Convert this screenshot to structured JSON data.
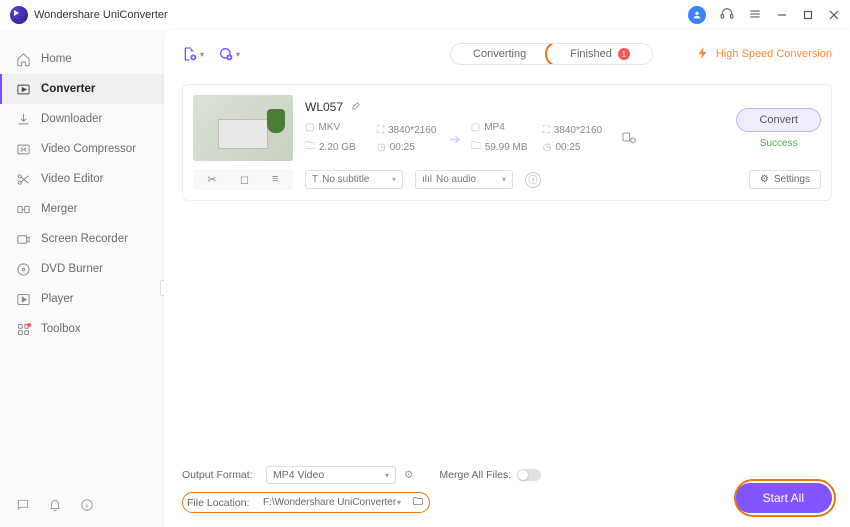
{
  "app": {
    "title": "Wondershare UniConverter"
  },
  "sidebar": {
    "items": [
      {
        "label": "Home"
      },
      {
        "label": "Converter"
      },
      {
        "label": "Downloader"
      },
      {
        "label": "Video Compressor"
      },
      {
        "label": "Video Editor"
      },
      {
        "label": "Merger"
      },
      {
        "label": "Screen Recorder"
      },
      {
        "label": "DVD Burner"
      },
      {
        "label": "Player"
      },
      {
        "label": "Toolbox"
      }
    ]
  },
  "topbar": {
    "tab_converting": "Converting",
    "tab_finished": "Finished",
    "finished_count": "1",
    "high_speed": "High Speed Conversion"
  },
  "file": {
    "name": "WL057",
    "src": {
      "format": "MKV",
      "res": "3840*2160",
      "size": "2.20 GB",
      "dur": "00:25"
    },
    "dst": {
      "format": "MP4",
      "res": "3840*2160",
      "size": "59.99 MB",
      "dur": "00:25"
    },
    "convert_label": "Convert",
    "status": "Success",
    "subtitle": "No subtitle",
    "audio": "No audio",
    "settings_label": "Settings"
  },
  "bottom": {
    "output_format_label": "Output Format:",
    "output_format_value": "MP4 Video",
    "merge_label": "Merge All Files:",
    "file_location_label": "File Location:",
    "file_location_value": "F:\\Wondershare UniConverter",
    "start_all": "Start All"
  }
}
